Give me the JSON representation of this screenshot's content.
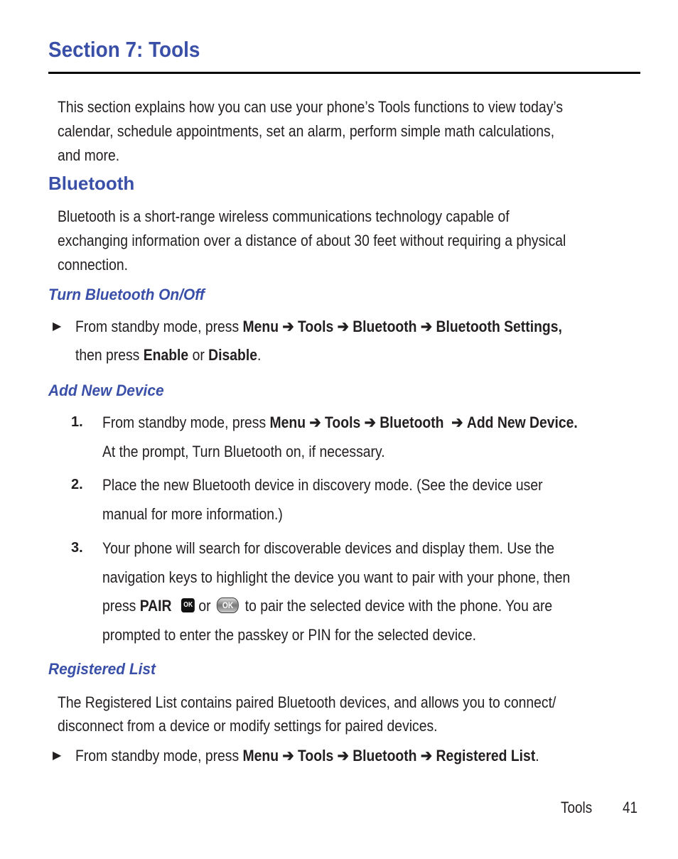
{
  "header": {
    "title": "Section 7: Tools"
  },
  "intro": {
    "lines": [
      "This section explains how you can use your phone’s Tools functions to view today’s",
      "calendar, schedule appointments, set an alarm, perform simple math calculations,",
      "and more."
    ]
  },
  "bluetooth": {
    "heading": "Bluetooth",
    "lines": [
      "Bluetooth is a short-range wireless communications technology capable of",
      "exchanging information over a distance of about 30 feet without requiring a physical",
      "connection."
    ]
  },
  "turn_on_off": {
    "heading": "Turn Bluetooth On/Off",
    "bullet_icon": "right-triangle-bullet",
    "line1_prefix": "From standby mode, press ",
    "path": [
      "Menu",
      "Tools",
      "Bluetooth",
      "Bluetooth Settings,"
    ],
    "arrow": "➔",
    "line2_prefix": "then press ",
    "enable": "Enable",
    "or": " or ",
    "disable": "Disable",
    "end": "."
  },
  "add_new_device": {
    "heading": "Add New Device",
    "steps": [
      {
        "num": "1.",
        "prefix": "From standby mode, press ",
        "path": [
          "Menu",
          "Tools",
          "Bluetooth",
          "Add New Device."
        ],
        "line2": "At the prompt, Turn Bluetooth on, if necessary."
      },
      {
        "num": "2.",
        "line1": "Place the new Bluetooth device in discovery mode. (See the device user",
        "line2": "manual for more information.)"
      },
      {
        "num": "3.",
        "line1": " Your phone will search for discoverable devices and display them.  Use the",
        "line2": "navigation keys to highlight the device you want to pair with your phone, then",
        "line3_prefix": "press ",
        "pair": "PAIR",
        "ok_key_label": "OK",
        "or": "or",
        "ok_button_label": "OK",
        "line3_suffix": "to pair the selected device with the phone. You are",
        "line4": "prompted to enter the passkey or PIN for the selected device."
      }
    ]
  },
  "registered_list": {
    "heading": "Registered List",
    "lines": [
      "The Registered List contains paired Bluetooth devices, and allows you to connect/",
      "disconnect from a device or modify settings for paired devices."
    ],
    "bullet_prefix": "From standby mode, press ",
    "path": [
      "Menu",
      "Tools",
      "Bluetooth",
      "Registered List"
    ],
    "end": "."
  },
  "footer": {
    "section": "Tools",
    "page_number": "41"
  }
}
